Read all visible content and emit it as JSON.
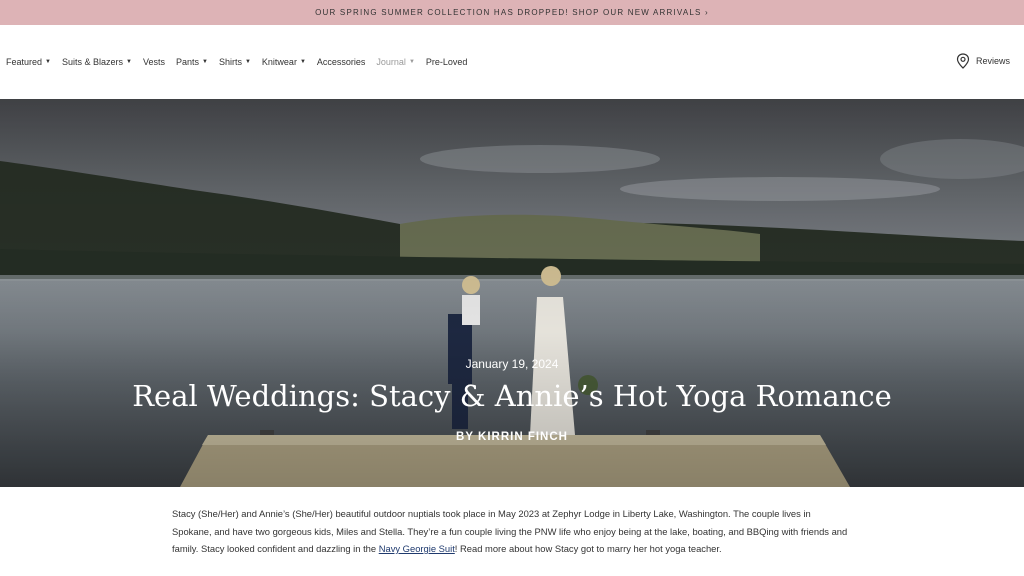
{
  "announcement": {
    "text": "OUR SPRING SUMMER COLLECTION HAS DROPPED! SHOP OUR NEW ARRIVALS ›"
  },
  "nav": {
    "items": [
      {
        "label": "Featured",
        "dropdown": true
      },
      {
        "label": "Suits & Blazers",
        "dropdown": true
      },
      {
        "label": "Vests",
        "dropdown": false
      },
      {
        "label": "Pants",
        "dropdown": true
      },
      {
        "label": "Shirts",
        "dropdown": true
      },
      {
        "label": "Knitwear",
        "dropdown": true
      },
      {
        "label": "Accessories",
        "dropdown": false
      },
      {
        "label": "Journal",
        "dropdown": true,
        "muted": true
      },
      {
        "label": "Pre-Loved",
        "dropdown": false
      }
    ],
    "reviews_label": "Reviews",
    "reviews_icon": "location-pin-icon"
  },
  "hero": {
    "date": "January 19, 2024",
    "title": "Real Weddings: Stacy & Annie’s Hot Yoga Romance",
    "byline": "BY KIRRIN FINCH"
  },
  "article": {
    "intro_part1": "Stacy (She/Her) and Annie’s (She/Her) beautiful outdoor nuptials took place in May 2023 at Zephyr Lodge in Liberty Lake, Washington. The couple lives in Spokane, and have two gorgeous kids, Miles and Stella. They’re a fun couple living the PNW life who enjoy being at the lake, boating, and BBQing with friends and family. Stacy looked confident and dazzling in the ",
    "intro_link": "Navy Georgie Suit",
    "intro_part2": "! Read more about how Stacy got to marry her hot yoga teacher."
  },
  "colors": {
    "announcement_bg": "#ddb3b6",
    "link": "#1f3a6e"
  }
}
